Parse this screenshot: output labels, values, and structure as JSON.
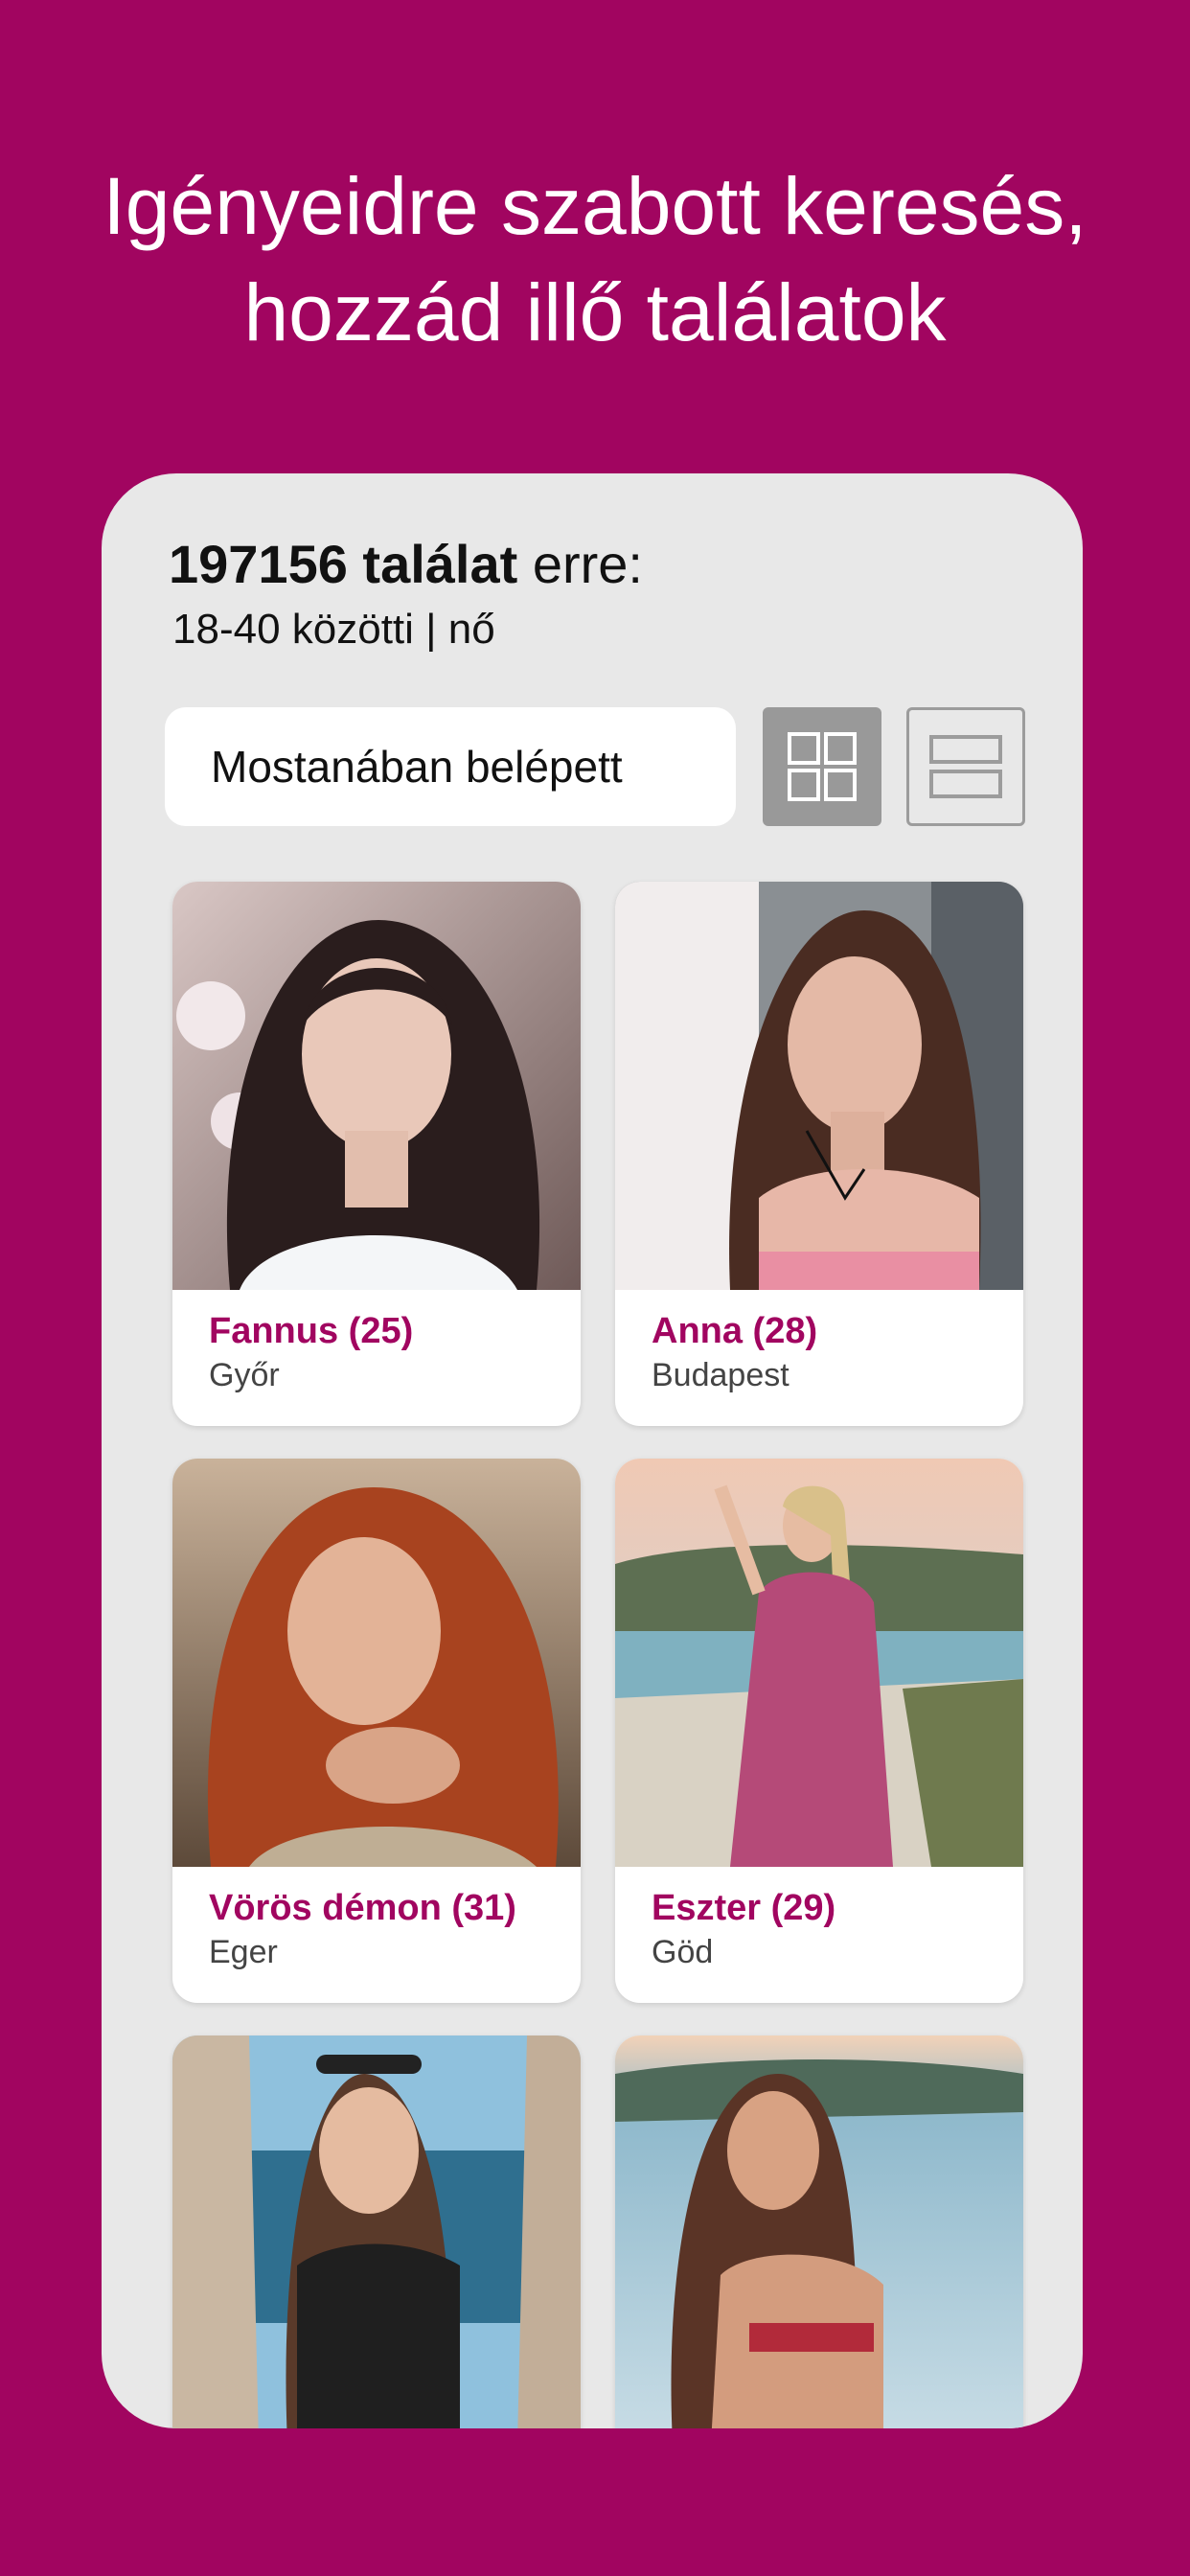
{
  "headline": {
    "line1": "Igényeidre szabott keresés,",
    "line2": "hozzád illő találatok"
  },
  "results": {
    "count": "197156 találat",
    "suffix": " erre:",
    "filter": "18-40 közötti | nő"
  },
  "sort": {
    "label": "Mostanában belépett"
  },
  "view_toggle": {
    "grid_icon": "grid-view-icon",
    "list_icon": "list-view-icon",
    "active": "grid"
  },
  "profiles": [
    {
      "name": "Fannus (25)",
      "city": "Győr"
    },
    {
      "name": "Anna (28)",
      "city": "Budapest"
    },
    {
      "name": "Vörös démon (31)",
      "city": "Eger"
    },
    {
      "name": "Eszter (29)",
      "city": "Göd"
    },
    {
      "name": "",
      "city": ""
    },
    {
      "name": "",
      "city": ""
    }
  ],
  "colors": {
    "brand": "#a10560",
    "panel": "#e8e8e8",
    "active_toggle": "#999999"
  }
}
